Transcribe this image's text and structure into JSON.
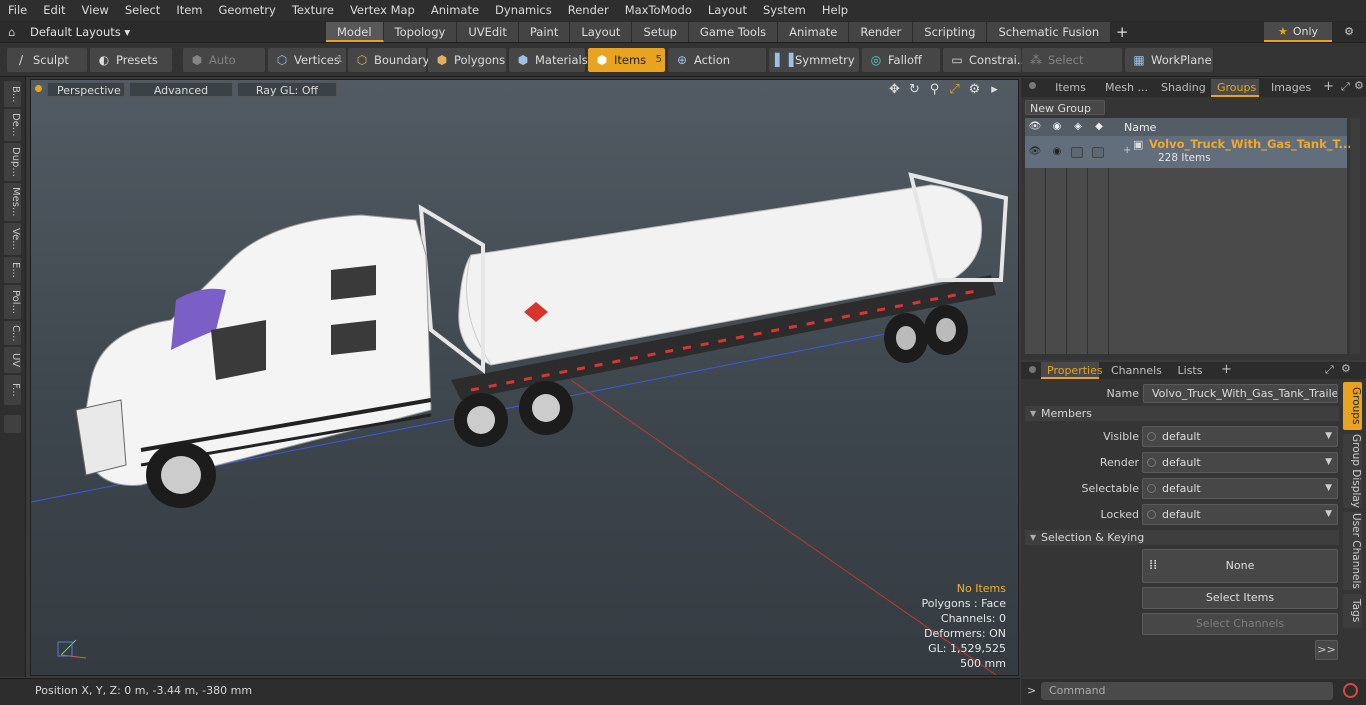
{
  "menu": [
    "File",
    "Edit",
    "View",
    "Select",
    "Item",
    "Geometry",
    "Texture",
    "Vertex Map",
    "Animate",
    "Dynamics",
    "Render",
    "MaxToModo",
    "Layout",
    "System",
    "Help"
  ],
  "layouts": {
    "label": "Default Layouts",
    "icon": "home-icon"
  },
  "mode_tabs": [
    "Model",
    "Topology",
    "UVEdit",
    "Paint",
    "Layout",
    "Setup",
    "Game Tools",
    "Animate",
    "Render",
    "Scripting",
    "Schematic Fusion"
  ],
  "active_mode_tab": "Model",
  "only_label": "Only",
  "toolbar": {
    "sculpt": "Sculpt",
    "presets": "Presets",
    "auto_select": "Auto Select",
    "vertices": "Vertices",
    "vertices_count": "1",
    "boundary": "Boundary",
    "polygons": "Polygons",
    "materials": "Materials",
    "items": "Items",
    "items_count": "5",
    "action_center": "Action Center",
    "symmetry": "Symmetry",
    "falloff": "Falloff",
    "constraints": "Constrai...",
    "select_through": "Select Through",
    "workplane": "WorkPlane"
  },
  "left_tabs": [
    "B...",
    "De...",
    "Dup...",
    "Mes...",
    "Ve...",
    "E...",
    "Pol...",
    "C...",
    "UV",
    "F..."
  ],
  "viewport": {
    "projection": "Perspective",
    "shading": "Advanced",
    "raygl": "Ray GL: Off",
    "info": {
      "items": "No Items",
      "polygons": "Polygons : Face",
      "channels": "Channels: 0",
      "deformers": "Deformers: ON",
      "gl": "GL: 1,529,525",
      "scale": "500 mm"
    },
    "colors": {
      "accent": "#e8a321",
      "grid_x": "#c0392b",
      "grid_z": "#3a5bd9"
    }
  },
  "status": {
    "position": "Position X, Y, Z:   0 m, -3.44 m, -380 mm"
  },
  "top_panel": {
    "tabs": [
      "Items",
      "Mesh ...",
      "Shading",
      "Groups",
      "Images"
    ],
    "active_tab": "Groups",
    "new_group": "New Group",
    "col_name": "Name",
    "group": {
      "name": "Volvo_Truck_With_Gas_Tank_T...",
      "count": "228 Items"
    }
  },
  "bottom_panel": {
    "tabs": [
      "Properties",
      "Channels",
      "Lists"
    ],
    "active_tab": "Properties",
    "name_label": "Name",
    "name_value": "Volvo_Truck_With_Gas_Tank_Trailer (:",
    "members_section": "Members",
    "visible_label": "Visible",
    "render_label": "Render",
    "selectable_label": "Selectable",
    "locked_label": "Locked",
    "dropdown_value": "default",
    "keying_section": "Selection & Keying",
    "none_label": "None",
    "select_items": "Select Items",
    "select_channels": "Select Channels",
    "more": ">>",
    "side_tabs": [
      "Groups",
      "Group Display",
      "User Channels",
      "Tags"
    ]
  },
  "command": {
    "placeholder": "Command",
    "prompt": ">"
  }
}
